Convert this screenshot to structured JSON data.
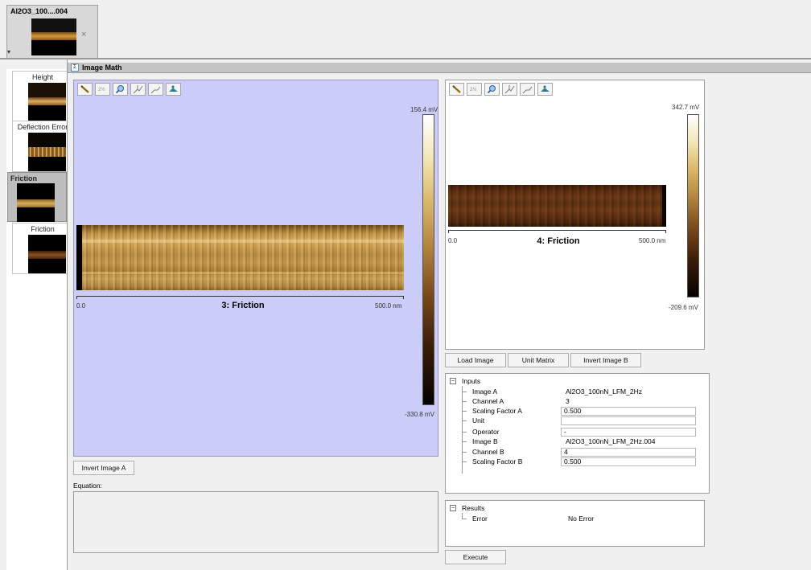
{
  "file_tab": {
    "title": "Al2O3_100....004",
    "close": "×",
    "dropdown": "▾"
  },
  "sidebar": [
    {
      "label": "Height",
      "selected": false
    },
    {
      "label": "Deflection Error",
      "selected": false
    },
    {
      "label": "Friction",
      "selected": true
    },
    {
      "label": "Friction",
      "selected": false
    }
  ],
  "window": {
    "title": "Image Math"
  },
  "panel_a": {
    "caption": "3: Friction",
    "x_start": "0.0",
    "x_end": "500.0 nm",
    "scale_max": "156.4 mV",
    "scale_min": "-330.8 mV",
    "tools": [
      "measure-icon",
      "zoom-reset-icon",
      "zoom-icon",
      "cross-section-icon",
      "profile-icon",
      "3d-view-icon"
    ]
  },
  "panel_b": {
    "caption": "4: Friction",
    "x_start": "0.0",
    "x_end": "500.0 nm",
    "scale_max": "342.7 mV",
    "scale_min": "-209.6 mV",
    "tools": [
      "measure-icon",
      "zoom-reset-icon",
      "zoom-icon",
      "cross-section-icon",
      "profile-icon",
      "3d-view-icon"
    ]
  },
  "buttons": {
    "load_image": "Load Image",
    "unit_matrix": "Unit Matrix",
    "invert_b": "Invert Image B",
    "invert_a": "Invert Image A",
    "execute": "Execute"
  },
  "equation": {
    "label": "Equation:",
    "value": ""
  },
  "inputs": {
    "header": "Inputs",
    "rows": [
      {
        "key": "Image A",
        "value": "Al2O3_100nN_LFM_2Hz",
        "editable": false
      },
      {
        "key": "Channel A",
        "value": "3",
        "editable": false
      },
      {
        "key": "Scaling Factor A",
        "value": "0.500",
        "editable": true
      },
      {
        "key": "Unit",
        "value": "",
        "editable": true
      },
      {
        "key": "Operator",
        "value": "-",
        "editable": true
      },
      {
        "key": "Image B",
        "value": "Al2O3_100nN_LFM_2Hz.004",
        "editable": false
      },
      {
        "key": "Channel B",
        "value": "4",
        "editable": true
      },
      {
        "key": "Scaling Factor B",
        "value": "0.500",
        "editable": true
      }
    ]
  },
  "results": {
    "header": "Results",
    "rows": [
      {
        "key": "Error",
        "value": "No Error"
      }
    ]
  },
  "colors": {
    "panel_a_bg": "#ccccf8",
    "friction_a": "#b78a3a",
    "friction_b": "#5a2e12"
  }
}
